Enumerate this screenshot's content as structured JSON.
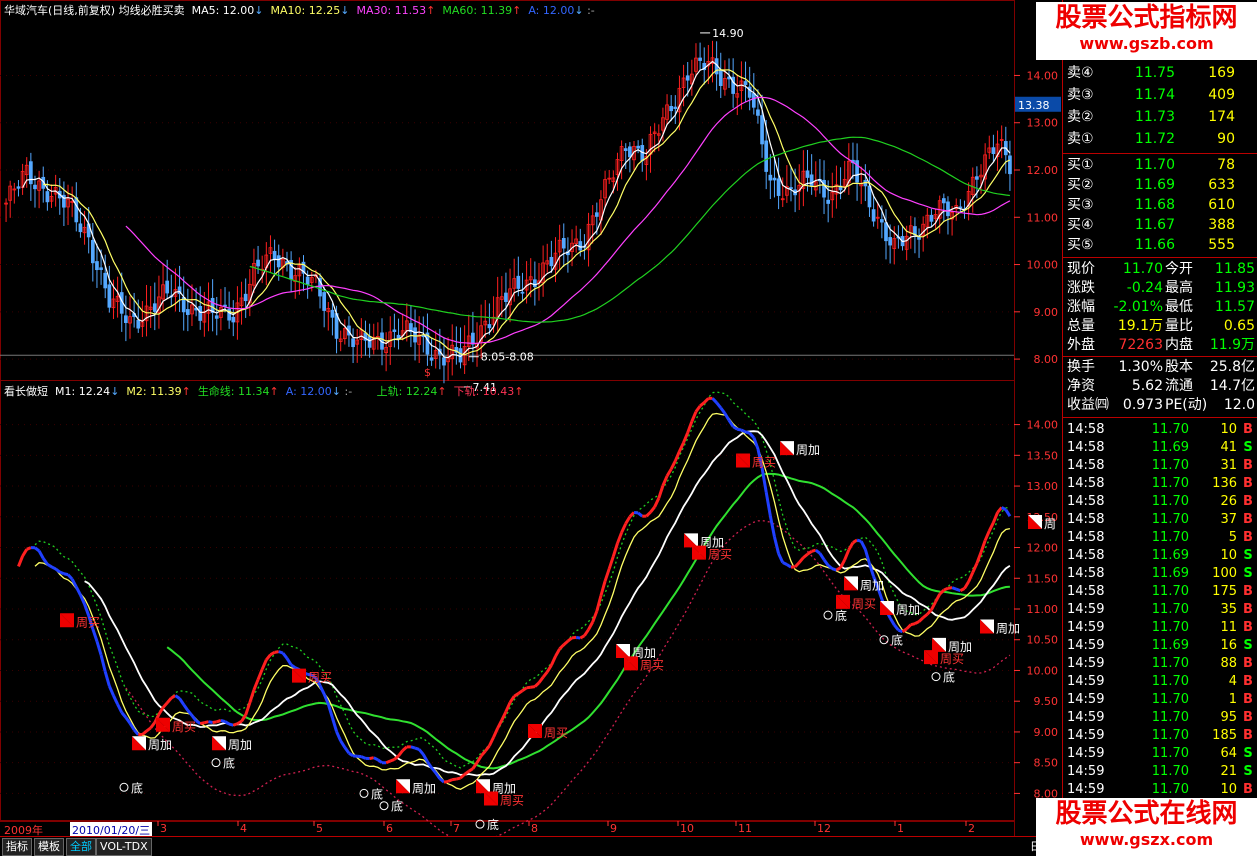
{
  "main_header": {
    "title": "华域汽车(日线,前复权) 均线必胜买卖",
    "ma5": "MA5: 12.00",
    "ma10": "MA10: 12.25",
    "ma30": "MA30: 11.53",
    "ma60": "MA60: 11.39",
    "a": "A: 12.00",
    "tail": ":-"
  },
  "sub_header": {
    "title": "看长做短",
    "m1": "M1: 12.24",
    "m2": "M2: 11.39",
    "life": "生命线: 11.34",
    "a": "A: 12.00",
    "sep": ":-",
    "upper": "上轨: 12.24",
    "lower": "下轨: 10.43"
  },
  "colors": {
    "up": "#ff2020",
    "down": "#3a6bff",
    "ma5": "#ffffff",
    "ma10": "#ffff66",
    "ma30": "#ff40ff",
    "ma60": "#20d020",
    "grid": "#800000",
    "axis": "#ff3333",
    "price_green": "#00ff00",
    "price_red": "#ff3030"
  },
  "chart_data": [
    {
      "type": "candlestick",
      "title": "华域汽车(日线,前复权) 均线必胜买卖",
      "ylim": [
        7.6,
        15.3
      ],
      "yticks": [
        "14.00",
        "13.00",
        "12.00",
        "11.00",
        "10.00",
        "9.00",
        "8.00"
      ],
      "current_price_label": "13.38",
      "annotations": [
        {
          "text": "14.90",
          "x_index": 168,
          "y": 14.9
        },
        {
          "text": "8.05-8.08",
          "x_index": 112,
          "y": 8.05
        },
        {
          "text": "7.41",
          "x_index": 110,
          "y": 7.41
        },
        {
          "text": "$",
          "x_index": 102,
          "y": 7.6
        }
      ],
      "x_count": 244,
      "series": [
        {
          "name": "MA5",
          "color": "#ffffff"
        },
        {
          "name": "MA10",
          "color": "#ffff66"
        },
        {
          "name": "MA30",
          "color": "#ff40ff"
        },
        {
          "name": "MA60",
          "color": "#20d020"
        }
      ],
      "anchor_prices": [
        [
          0,
          11.3
        ],
        [
          5,
          11.9
        ],
        [
          10,
          11.6
        ],
        [
          15,
          11.2
        ],
        [
          20,
          10.6
        ],
        [
          25,
          9.2
        ],
        [
          30,
          8.8
        ],
        [
          35,
          9.1
        ],
        [
          40,
          9.4
        ],
        [
          45,
          9.1
        ],
        [
          50,
          8.9
        ],
        [
          55,
          9.0
        ],
        [
          60,
          9.8
        ],
        [
          65,
          10.2
        ],
        [
          70,
          9.9
        ],
        [
          75,
          9.5
        ],
        [
          80,
          8.7
        ],
        [
          85,
          8.3
        ],
        [
          90,
          8.4
        ],
        [
          95,
          8.6
        ],
        [
          100,
          8.4
        ],
        [
          105,
          8.1
        ],
        [
          110,
          8.0
        ],
        [
          115,
          8.7
        ],
        [
          120,
          9.2
        ],
        [
          125,
          9.6
        ],
        [
          130,
          9.9
        ],
        [
          135,
          10.3
        ],
        [
          140,
          10.6
        ],
        [
          145,
          11.5
        ],
        [
          150,
          12.6
        ],
        [
          155,
          12.3
        ],
        [
          160,
          13.2
        ],
        [
          165,
          14.1
        ],
        [
          170,
          14.2
        ],
        [
          175,
          13.9
        ],
        [
          180,
          13.6
        ],
        [
          185,
          11.8
        ],
        [
          190,
          11.5
        ],
        [
          195,
          11.8
        ],
        [
          200,
          11.5
        ],
        [
          205,
          12.0
        ],
        [
          210,
          11.2
        ],
        [
          215,
          10.3
        ],
        [
          220,
          10.7
        ],
        [
          225,
          11.2
        ],
        [
          230,
          11.0
        ],
        [
          235,
          12.0
        ],
        [
          240,
          12.5
        ],
        [
          243,
          12.1
        ]
      ]
    },
    {
      "type": "line",
      "title": "看长做短",
      "ylim": [
        7.6,
        14.4
      ],
      "yticks": [
        "14.00",
        "13.50",
        "13.00",
        "12.50",
        "12.00",
        "11.50",
        "11.00",
        "10.50",
        "10.00",
        "9.50",
        "9.00",
        "8.50",
        "8.00"
      ],
      "series": [
        {
          "name": "M1",
          "color": "#ff2020"
        },
        {
          "name": "M2",
          "color": "#ffffff"
        },
        {
          "name": "生命线",
          "color": "#20d020"
        },
        {
          "name": "上轨",
          "color": "#20d020"
        },
        {
          "name": "下轨",
          "color": "#d02050"
        }
      ],
      "signals": [
        {
          "text": "周买",
          "x_index": 16,
          "y": 10.8
        },
        {
          "text": "周加",
          "x_index": 34,
          "y": 8.8
        },
        {
          "text": "周买",
          "x_index": 40,
          "y": 9.1
        },
        {
          "text": "底",
          "x_index": 30,
          "y": 8.1
        },
        {
          "text": "周加",
          "x_index": 54,
          "y": 8.8
        },
        {
          "text": "底",
          "x_index": 53,
          "y": 8.5
        },
        {
          "text": "周买",
          "x_index": 74,
          "y": 9.9
        },
        {
          "text": "底",
          "x_index": 90,
          "y": 8.0
        },
        {
          "text": "底",
          "x_index": 95,
          "y": 7.8
        },
        {
          "text": "周加",
          "x_index": 100,
          "y": 8.1
        },
        {
          "text": "周加",
          "x_index": 120,
          "y": 8.1
        },
        {
          "text": "周买",
          "x_index": 122,
          "y": 7.9
        },
        {
          "text": "底",
          "x_index": 119,
          "y": 7.5
        },
        {
          "text": "周买",
          "x_index": 133,
          "y": 9.0
        },
        {
          "text": "周加",
          "x_index": 155,
          "y": 10.3
        },
        {
          "text": "周买",
          "x_index": 157,
          "y": 10.1
        },
        {
          "text": "周加",
          "x_index": 172,
          "y": 12.1
        },
        {
          "text": "周买",
          "x_index": 174,
          "y": 11.9
        },
        {
          "text": "周买",
          "x_index": 185,
          "y": 13.4
        },
        {
          "text": "周加",
          "x_index": 196,
          "y": 13.6
        },
        {
          "text": "周加",
          "x_index": 212,
          "y": 11.4
        },
        {
          "text": "周买",
          "x_index": 210,
          "y": 11.1
        },
        {
          "text": "底",
          "x_index": 206,
          "y": 10.9
        },
        {
          "text": "周加",
          "x_index": 221,
          "y": 11.0
        },
        {
          "text": "底",
          "x_index": 220,
          "y": 10.5
        },
        {
          "text": "周加",
          "x_index": 234,
          "y": 10.4
        },
        {
          "text": "周买",
          "x_index": 232,
          "y": 10.2
        },
        {
          "text": "底",
          "x_index": 233,
          "y": 9.9
        },
        {
          "text": "周加",
          "x_index": 246,
          "y": 10.7
        },
        {
          "text": "周",
          "x_index": 258,
          "y": 12.4
        }
      ]
    }
  ],
  "x_axis": {
    "year_label": "2009年",
    "date_box": "2010/01/20/三",
    "months": [
      "3",
      "4",
      "5",
      "6",
      "7",
      "8",
      "9",
      "10",
      "11",
      "12",
      "1",
      "2"
    ],
    "right_tag": "日"
  },
  "bottom_tabs": [
    "指标",
    "模板",
    "全部",
    "VOL-TDX"
  ],
  "watermark_top": {
    "line1": "股票公式指标网",
    "line2": "www.gszb.com"
  },
  "watermark_bottom": {
    "line1": "股票公式在线网",
    "line2": "www.gszx.com"
  },
  "order_book": {
    "sell": [
      {
        "label": "卖④",
        "price": "11.75",
        "vol": "169"
      },
      {
        "label": "卖③",
        "price": "11.74",
        "vol": "409"
      },
      {
        "label": "卖②",
        "price": "11.73",
        "vol": "174"
      },
      {
        "label": "卖①",
        "price": "11.72",
        "vol": "90"
      }
    ],
    "buy": [
      {
        "label": "买①",
        "price": "11.70",
        "vol": "78"
      },
      {
        "label": "买②",
        "price": "11.69",
        "vol": "633"
      },
      {
        "label": "买③",
        "price": "11.68",
        "vol": "610"
      },
      {
        "label": "买④",
        "price": "11.67",
        "vol": "388"
      },
      {
        "label": "买⑤",
        "price": "11.66",
        "vol": "555"
      }
    ]
  },
  "stats": [
    {
      "l1": "现价",
      "v1": "11.70",
      "c1": "#00ff00",
      "l2": "今开",
      "v2": "11.85",
      "c2": "#00ff00"
    },
    {
      "l1": "涨跌",
      "v1": "-0.24",
      "c1": "#00ff00",
      "l2": "最高",
      "v2": "11.93",
      "c2": "#00ff00"
    },
    {
      "l1": "涨幅",
      "v1": "-2.01%",
      "c1": "#00ff00",
      "l2": "最低",
      "v2": "11.57",
      "c2": "#00ff00"
    },
    {
      "l1": "总量",
      "v1": "19.1万",
      "c1": "#ffff00",
      "l2": "量比",
      "v2": "0.65",
      "c2": "#ffff00"
    },
    {
      "l1": "外盘",
      "v1": "72263",
      "c1": "#ff3030",
      "l2": "内盘",
      "v2": "11.9万",
      "c2": "#00ff00"
    },
    {
      "l1": "换手",
      "v1": "1.30%",
      "c1": "#ffffff",
      "l2": "股本",
      "v2": "25.8亿",
      "c2": "#ffffff"
    },
    {
      "l1": "净资",
      "v1": "5.62",
      "c1": "#ffffff",
      "l2": "流通",
      "v2": "14.7亿",
      "c2": "#ffffff"
    },
    {
      "l1": "收益㈣",
      "v1": "0.973",
      "c1": "#ffffff",
      "l2": "PE(动)",
      "v2": "12.0",
      "c2": "#ffffff"
    }
  ],
  "ticks": [
    {
      "time": "14:58",
      "price": "11.70",
      "vol": "10",
      "dir": "B"
    },
    {
      "time": "14:58",
      "price": "11.69",
      "vol": "41",
      "dir": "S"
    },
    {
      "time": "14:58",
      "price": "11.70",
      "vol": "31",
      "dir": "B"
    },
    {
      "time": "14:58",
      "price": "11.70",
      "vol": "136",
      "dir": "B"
    },
    {
      "time": "14:58",
      "price": "11.70",
      "vol": "26",
      "dir": "B"
    },
    {
      "time": "14:58",
      "price": "11.70",
      "vol": "37",
      "dir": "B"
    },
    {
      "time": "14:58",
      "price": "11.70",
      "vol": "5",
      "dir": "B"
    },
    {
      "time": "14:58",
      "price": "11.69",
      "vol": "10",
      "dir": "S"
    },
    {
      "time": "14:58",
      "price": "11.69",
      "vol": "100",
      "dir": "S"
    },
    {
      "time": "14:58",
      "price": "11.70",
      "vol": "175",
      "dir": "B"
    },
    {
      "time": "14:59",
      "price": "11.70",
      "vol": "35",
      "dir": "B"
    },
    {
      "time": "14:59",
      "price": "11.70",
      "vol": "11",
      "dir": "B"
    },
    {
      "time": "14:59",
      "price": "11.69",
      "vol": "16",
      "dir": "S"
    },
    {
      "time": "14:59",
      "price": "11.70",
      "vol": "88",
      "dir": "B"
    },
    {
      "time": "14:59",
      "price": "11.70",
      "vol": "4",
      "dir": "B"
    },
    {
      "time": "14:59",
      "price": "11.70",
      "vol": "1",
      "dir": "B"
    },
    {
      "time": "14:59",
      "price": "11.70",
      "vol": "95",
      "dir": "B"
    },
    {
      "time": "14:59",
      "price": "11.70",
      "vol": "185",
      "dir": "B"
    },
    {
      "time": "14:59",
      "price": "11.70",
      "vol": "64",
      "dir": "S"
    },
    {
      "time": "14:59",
      "price": "11.70",
      "vol": "21",
      "dir": "S"
    },
    {
      "time": "14:59",
      "price": "11.70",
      "vol": "10",
      "dir": "B"
    }
  ]
}
